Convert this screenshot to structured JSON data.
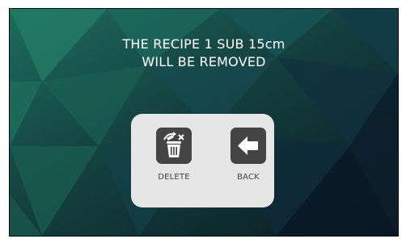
{
  "dialog": {
    "message_line1": "THE RECIPE 1  SUB 15cm",
    "message_line2": "WILL BE REMOVED",
    "delete_label": "DELETE",
    "back_label": "BACK",
    "delete_icon": "trash-icon",
    "back_icon": "arrow-left-icon"
  },
  "colors": {
    "background": "#0b2a2c",
    "dialog_panel": "#e6e6e6",
    "button_tile": "#444444",
    "message_text": "#ffffff"
  }
}
